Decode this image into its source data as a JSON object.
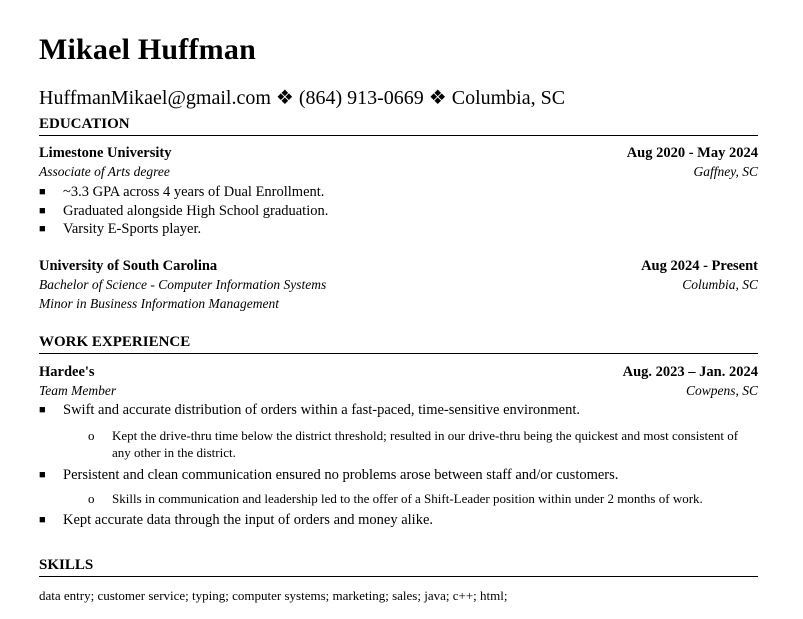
{
  "header": {
    "name": "Mikael Huffman",
    "contact": "HuffmanMikael@gmail.com ❖ (864) 913-0669 ❖ Columbia, SC"
  },
  "education": {
    "title": "EDUCATION",
    "entries": [
      {
        "school": "Limestone University",
        "dates": "Aug 2020 - May 2024",
        "degree": "Associate of Arts degree",
        "location": "Gaffney, SC",
        "bullets": [
          "~3.3 GPA across 4 years of Dual Enrollment.",
          "Graduated alongside High School graduation.",
          "Varsity E-Sports player."
        ]
      },
      {
        "school": "University of South Carolina",
        "dates": "Aug 2024 - Present",
        "degree": "Bachelor of Science - Computer Information Systems",
        "location": "Columbia, SC",
        "minor": "Minor in Business Information Management"
      }
    ]
  },
  "work": {
    "title": "WORK EXPERIENCE",
    "employer": "Hardee's",
    "dates": "Aug. 2023 – Jan. 2024",
    "role": "Team Member",
    "location": "Cowpens, SC",
    "bullets": [
      "Swift and accurate distribution of orders within a fast-paced, time-sensitive environment.",
      "Persistent and clean communication ensured no problems arose between staff and/or customers.",
      "Kept accurate data through the input of orders and money alike."
    ],
    "subbullets": [
      "Kept the drive-thru time below the district threshold; resulted in our drive-thru being the quickest and most consistent of any other in the district.",
      "Skills in communication and leadership led to the offer of a Shift-Leader position within under 2 months of work."
    ]
  },
  "skills": {
    "title": "SKILLS",
    "text": "data entry; customer service; typing; computer systems; marketing; sales; java; c++; html;"
  }
}
